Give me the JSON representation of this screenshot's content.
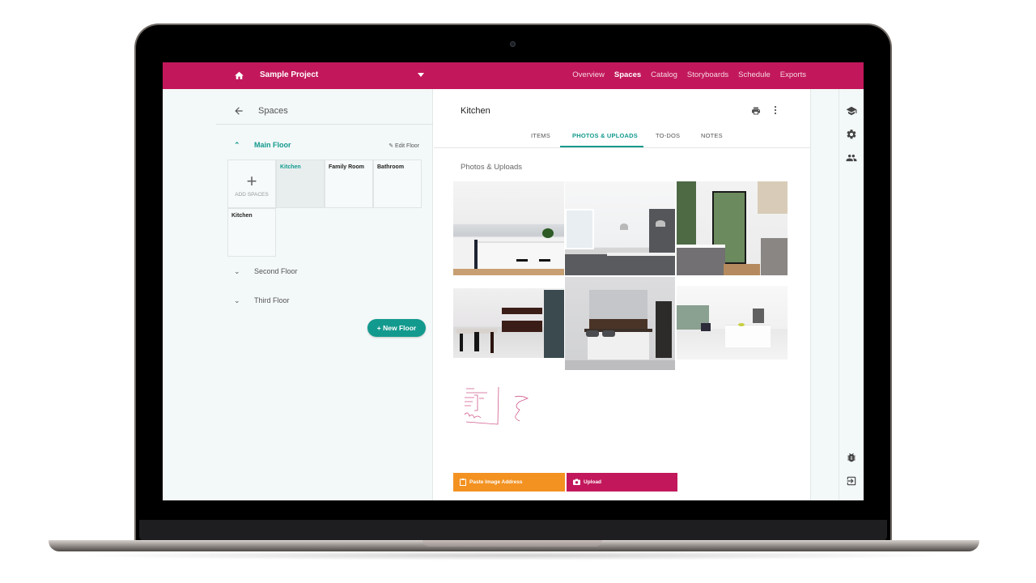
{
  "topbar": {
    "project_name": "Sample Project",
    "nav": [
      {
        "label": "Overview",
        "active": false
      },
      {
        "label": "Spaces",
        "active": true
      },
      {
        "label": "Catalog",
        "active": false
      },
      {
        "label": "Storyboards",
        "active": false
      },
      {
        "label": "Schedule",
        "active": false
      },
      {
        "label": "Exports",
        "active": false
      }
    ]
  },
  "left_panel": {
    "title": "Spaces",
    "floors": [
      {
        "label": "Main Floor",
        "expanded": true
      },
      {
        "label": "Second Floor",
        "expanded": false
      },
      {
        "label": "Third Floor",
        "expanded": false
      }
    ],
    "edit_floor_label": "Edit Floor",
    "add_spaces_label": "ADD SPACES",
    "spaces": [
      "Kitchen",
      "Family Room",
      "Bathroom",
      "Kitchen"
    ],
    "active_space": "Kitchen",
    "new_floor_label": "New Floor"
  },
  "center": {
    "title": "Kitchen",
    "tabs": [
      {
        "label": "ITEMS",
        "active": false
      },
      {
        "label": "PHOTOS & UPLOADS",
        "active": true
      },
      {
        "label": "TO-DOS",
        "active": false
      },
      {
        "label": "NOTES",
        "active": false
      }
    ],
    "section_title": "Photos & Uploads",
    "photos": [
      "white kitchen with marble backsplash",
      "kitchen with pendant lights and dark cabinets",
      "kitchen with tall black-framed windows",
      "open kitchen with dining table and dark cabinetry",
      "grey kitchen with bar stools and pendant lights",
      "bright white kitchen with island and stools"
    ],
    "sketch": "hand-drawn floor plan sketch",
    "paste_label": "Paste Image Address",
    "upload_label": "Upload"
  },
  "icons": {
    "home": "home-icon",
    "caret": "caret-down-icon",
    "back": "arrow-left-icon",
    "print": "print-icon",
    "more": "more-vert-icon",
    "rail_top": [
      "graduation-cap-icon",
      "gear-icon",
      "people-icon"
    ],
    "rail_bottom": [
      "bug-icon",
      "logout-icon"
    ]
  },
  "colors": {
    "brand": "#c2185b",
    "accent": "#139a8e",
    "paste_button": "#f39221"
  }
}
